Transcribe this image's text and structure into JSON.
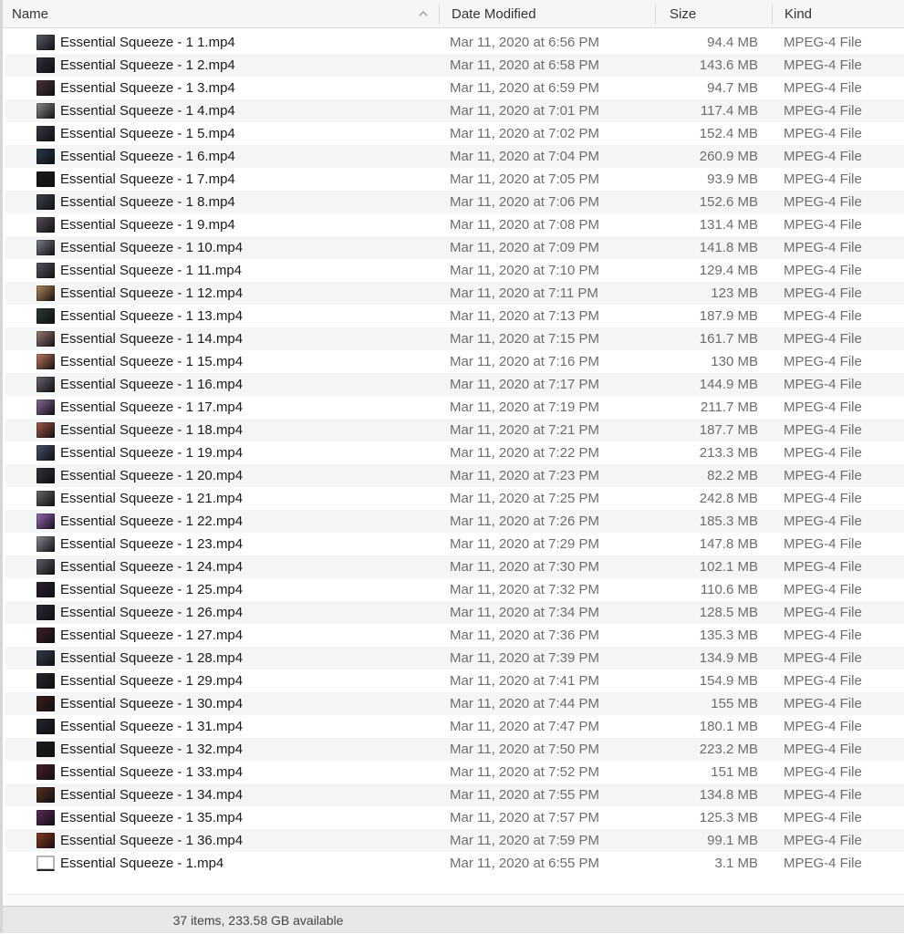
{
  "header": {
    "name_label": "Name",
    "date_label": "Date Modified",
    "size_label": "Size",
    "kind_label": "Kind",
    "sort_icon": "chevron-up-icon"
  },
  "files": [
    {
      "name": "Essential Squeeze - 1 1.mp4",
      "date": "Mar 11, 2020 at 6:56 PM",
      "size": "94.4 MB",
      "kind": "MPEG-4 File",
      "thumb": "#5a5d66"
    },
    {
      "name": "Essential Squeeze - 1 2.mp4",
      "date": "Mar 11, 2020 at 6:58 PM",
      "size": "143.6 MB",
      "kind": "MPEG-4 File",
      "thumb": "#2e3038"
    },
    {
      "name": "Essential Squeeze - 1 3.mp4",
      "date": "Mar 11, 2020 at 6:59 PM",
      "size": "94.7 MB",
      "kind": "MPEG-4 File",
      "thumb": "#4a3438"
    },
    {
      "name": "Essential Squeeze - 1 4.mp4",
      "date": "Mar 11, 2020 at 7:01 PM",
      "size": "117.4 MB",
      "kind": "MPEG-4 File",
      "thumb": "#8c8a8e"
    },
    {
      "name": "Essential Squeeze - 1 5.mp4",
      "date": "Mar 11, 2020 at 7:02 PM",
      "size": "152.4 MB",
      "kind": "MPEG-4 File",
      "thumb": "#3b3640"
    },
    {
      "name": "Essential Squeeze - 1 6.mp4",
      "date": "Mar 11, 2020 at 7:04 PM",
      "size": "260.9 MB",
      "kind": "MPEG-4 File",
      "thumb": "#26384a"
    },
    {
      "name": "Essential Squeeze - 1 7.mp4",
      "date": "Mar 11, 2020 at 7:05 PM",
      "size": "93.9 MB",
      "kind": "MPEG-4 File",
      "thumb": "#1a1a1e"
    },
    {
      "name": "Essential Squeeze - 1 8.mp4",
      "date": "Mar 11, 2020 at 7:06 PM",
      "size": "152.6 MB",
      "kind": "MPEG-4 File",
      "thumb": "#3e4250"
    },
    {
      "name": "Essential Squeeze - 1 9.mp4",
      "date": "Mar 11, 2020 at 7:08 PM",
      "size": "131.4 MB",
      "kind": "MPEG-4 File",
      "thumb": "#5a4e5a"
    },
    {
      "name": "Essential Squeeze - 1 10.mp4",
      "date": "Mar 11, 2020 at 7:09 PM",
      "size": "141.8 MB",
      "kind": "MPEG-4 File",
      "thumb": "#7a7c86"
    },
    {
      "name": "Essential Squeeze - 1 11.mp4",
      "date": "Mar 11, 2020 at 7:10 PM",
      "size": "129.4 MB",
      "kind": "MPEG-4 File",
      "thumb": "#55585e"
    },
    {
      "name": "Essential Squeeze - 1 12.mp4",
      "date": "Mar 11, 2020 at 7:11 PM",
      "size": "123 MB",
      "kind": "MPEG-4 File",
      "thumb": "#b88a5a"
    },
    {
      "name": "Essential Squeeze - 1 13.mp4",
      "date": "Mar 11, 2020 at 7:13 PM",
      "size": "187.9 MB",
      "kind": "MPEG-4 File",
      "thumb": "#2c3a30"
    },
    {
      "name": "Essential Squeeze - 1 14.mp4",
      "date": "Mar 11, 2020 at 7:15 PM",
      "size": "161.7 MB",
      "kind": "MPEG-4 File",
      "thumb": "#9a7a70"
    },
    {
      "name": "Essential Squeeze - 1 15.mp4",
      "date": "Mar 11, 2020 at 7:16 PM",
      "size": "130 MB",
      "kind": "MPEG-4 File",
      "thumb": "#c07860"
    },
    {
      "name": "Essential Squeeze - 1 16.mp4",
      "date": "Mar 11, 2020 at 7:17 PM",
      "size": "144.9 MB",
      "kind": "MPEG-4 File",
      "thumb": "#6a6470"
    },
    {
      "name": "Essential Squeeze - 1 17.mp4",
      "date": "Mar 11, 2020 at 7:19 PM",
      "size": "211.7 MB",
      "kind": "MPEG-4 File",
      "thumb": "#8a6a9a"
    },
    {
      "name": "Essential Squeeze - 1 18.mp4",
      "date": "Mar 11, 2020 at 7:21 PM",
      "size": "187.7 MB",
      "kind": "MPEG-4 File",
      "thumb": "#a65a4a"
    },
    {
      "name": "Essential Squeeze - 1 19.mp4",
      "date": "Mar 11, 2020 at 7:22 PM",
      "size": "213.3 MB",
      "kind": "MPEG-4 File",
      "thumb": "#4a5068"
    },
    {
      "name": "Essential Squeeze - 1 20.mp4",
      "date": "Mar 11, 2020 at 7:23 PM",
      "size": "82.2 MB",
      "kind": "MPEG-4 File",
      "thumb": "#303236"
    },
    {
      "name": "Essential Squeeze - 1 21.mp4",
      "date": "Mar 11, 2020 at 7:25 PM",
      "size": "242.8 MB",
      "kind": "MPEG-4 File",
      "thumb": "#6a6668"
    },
    {
      "name": "Essential Squeeze - 1 22.mp4",
      "date": "Mar 11, 2020 at 7:26 PM",
      "size": "185.3 MB",
      "kind": "MPEG-4 File",
      "thumb": "#9a6aba"
    },
    {
      "name": "Essential Squeeze - 1 23.mp4",
      "date": "Mar 11, 2020 at 7:29 PM",
      "size": "147.8 MB",
      "kind": "MPEG-4 File",
      "thumb": "#8a8c92"
    },
    {
      "name": "Essential Squeeze - 1 24.mp4",
      "date": "Mar 11, 2020 at 7:30 PM",
      "size": "102.1 MB",
      "kind": "MPEG-4 File",
      "thumb": "#5e6066"
    },
    {
      "name": "Essential Squeeze - 1 25.mp4",
      "date": "Mar 11, 2020 at 7:32 PM",
      "size": "110.6 MB",
      "kind": "MPEG-4 File",
      "thumb": "#2a2030"
    },
    {
      "name": "Essential Squeeze - 1 26.mp4",
      "date": "Mar 11, 2020 at 7:34 PM",
      "size": "128.5 MB",
      "kind": "MPEG-4 File",
      "thumb": "#2c2a34"
    },
    {
      "name": "Essential Squeeze - 1 27.mp4",
      "date": "Mar 11, 2020 at 7:36 PM",
      "size": "135.3 MB",
      "kind": "MPEG-4 File",
      "thumb": "#3a2028"
    },
    {
      "name": "Essential Squeeze - 1 28.mp4",
      "date": "Mar 11, 2020 at 7:39 PM",
      "size": "134.9 MB",
      "kind": "MPEG-4 File",
      "thumb": "#343a4c"
    },
    {
      "name": "Essential Squeeze - 1 29.mp4",
      "date": "Mar 11, 2020 at 7:41 PM",
      "size": "154.9 MB",
      "kind": "MPEG-4 File",
      "thumb": "#28262c"
    },
    {
      "name": "Essential Squeeze - 1 30.mp4",
      "date": "Mar 11, 2020 at 7:44 PM",
      "size": "155 MB",
      "kind": "MPEG-4 File",
      "thumb": "#3a1c1c"
    },
    {
      "name": "Essential Squeeze - 1 31.mp4",
      "date": "Mar 11, 2020 at 7:47 PM",
      "size": "180.1 MB",
      "kind": "MPEG-4 File",
      "thumb": "#22262e"
    },
    {
      "name": "Essential Squeeze - 1 32.mp4",
      "date": "Mar 11, 2020 at 7:50 PM",
      "size": "223.2 MB",
      "kind": "MPEG-4 File",
      "thumb": "#1e1e22"
    },
    {
      "name": "Essential Squeeze - 1 33.mp4",
      "date": "Mar 11, 2020 at 7:52 PM",
      "size": "151 MB",
      "kind": "MPEG-4 File",
      "thumb": "#4a1e30"
    },
    {
      "name": "Essential Squeeze - 1 34.mp4",
      "date": "Mar 11, 2020 at 7:55 PM",
      "size": "134.8 MB",
      "kind": "MPEG-4 File",
      "thumb": "#5a3020"
    },
    {
      "name": "Essential Squeeze - 1 35.mp4",
      "date": "Mar 11, 2020 at 7:57 PM",
      "size": "125.3 MB",
      "kind": "MPEG-4 File",
      "thumb": "#5a2a5a"
    },
    {
      "name": "Essential Squeeze - 1 36.mp4",
      "date": "Mar 11, 2020 at 7:59 PM",
      "size": "99.1 MB",
      "kind": "MPEG-4 File",
      "thumb": "#8a3a20"
    },
    {
      "name": "Essential Squeeze - 1.mp4",
      "date": "Mar 11, 2020 at 6:55 PM",
      "size": "3.1 MB",
      "kind": "MPEG-4 File",
      "thumb": "blank"
    }
  ],
  "status": "37 items, 233.58 GB available"
}
